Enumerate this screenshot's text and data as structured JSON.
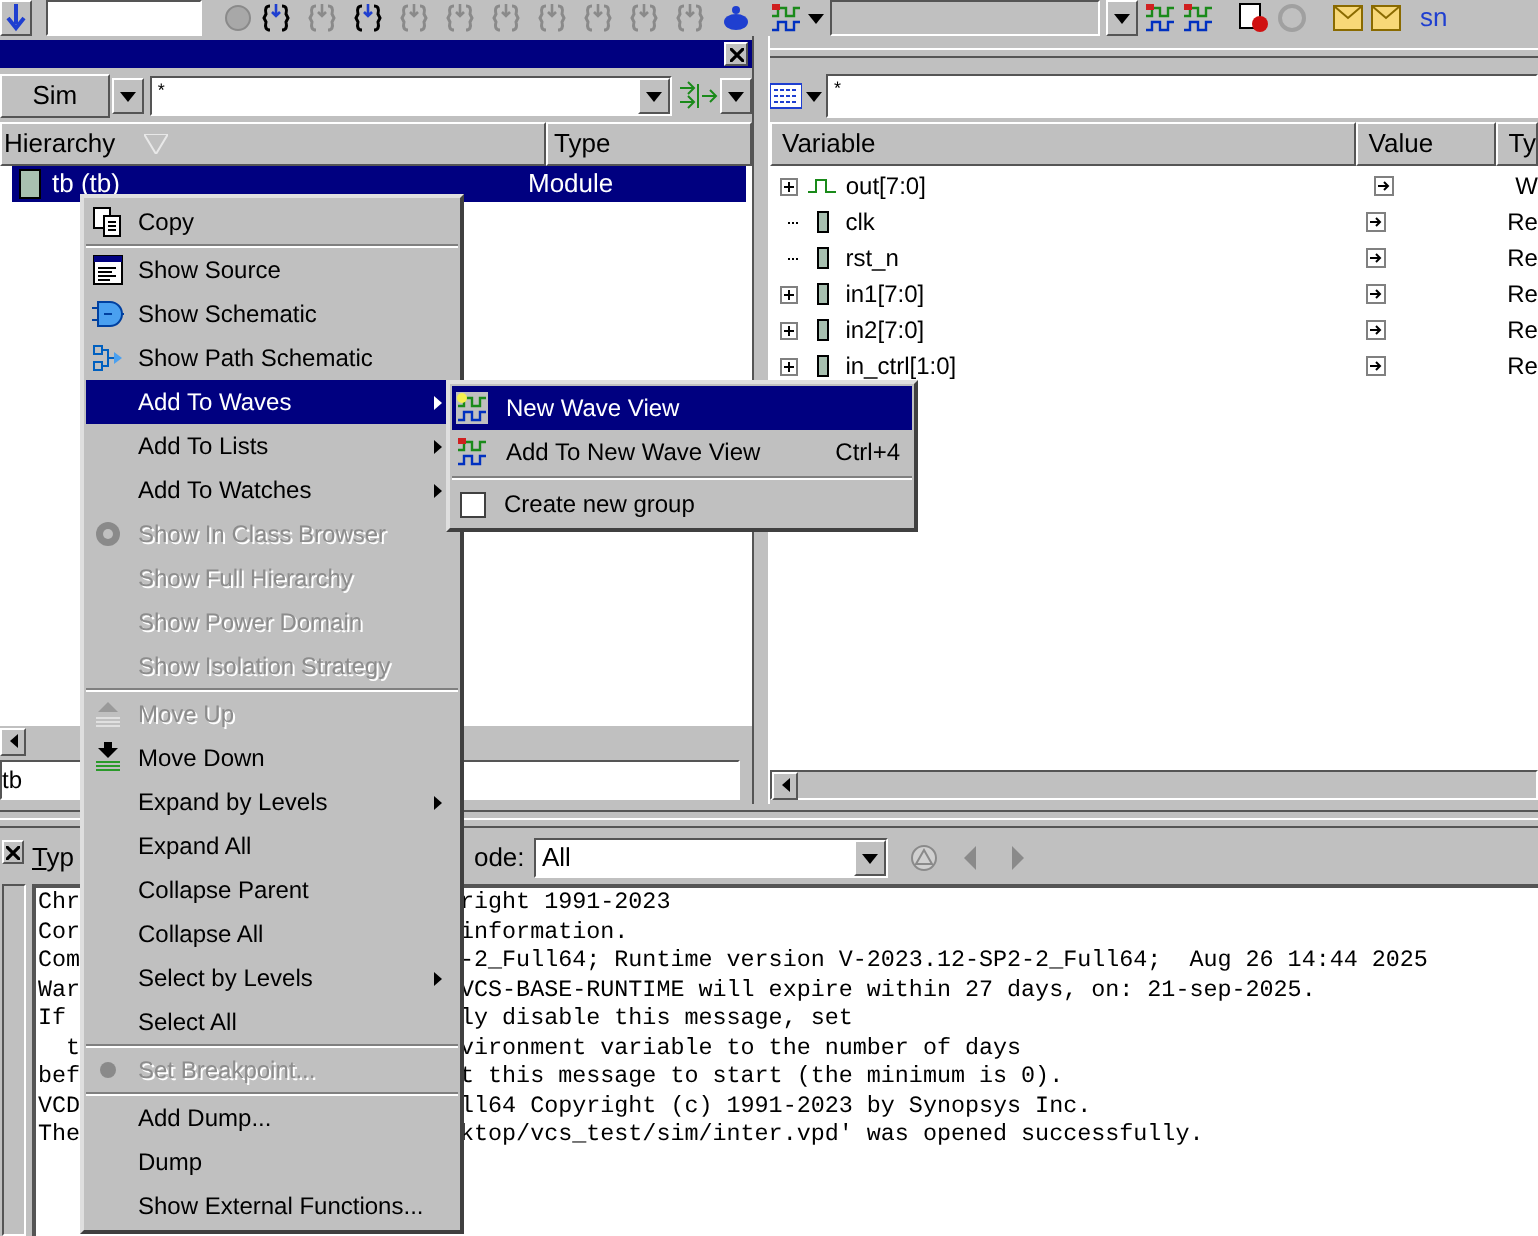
{
  "toolbar": {
    "logo": "sn"
  },
  "hierarchy_pane": {
    "scope_button": "Sim",
    "filter": "*",
    "columns": [
      "Hierarchy",
      "Type"
    ],
    "rows": [
      {
        "name": "tb (tb)",
        "type": "Module",
        "selected": true
      }
    ],
    "scope_field": "tb"
  },
  "variable_pane": {
    "filter": "*",
    "columns": [
      "Variable",
      "Value",
      "Ty"
    ],
    "rows": [
      {
        "name": "out[7:0]",
        "kind": "wire",
        "type": "W",
        "expandable": true
      },
      {
        "name": "clk",
        "kind": "reg",
        "type": "Re",
        "expandable": false
      },
      {
        "name": "rst_n",
        "kind": "reg",
        "type": "Re",
        "expandable": false
      },
      {
        "name": "in1[7:0]",
        "kind": "reg",
        "type": "Re",
        "expandable": true
      },
      {
        "name": "in2[7:0]",
        "kind": "reg",
        "type": "Re",
        "expandable": true
      },
      {
        "name": "in_ctrl[1:0]",
        "kind": "reg",
        "type": "Re",
        "expandable": true
      }
    ]
  },
  "console": {
    "type_label": "Typ",
    "mode_label": "ode:",
    "mode_value": "All",
    "lines": [
      {
        "left": "Chr",
        "right": "right 1991-2023"
      },
      {
        "left": "Cor",
        "right": "information."
      },
      {
        "left": "Com",
        "right": "-2_Full64; Runtime version V-2023.12-SP2-2_Full64;  Aug 26 14:44 2025"
      },
      {
        "left": "War",
        "right": "VCS-BASE-RUNTIME will expire within 27 days, on: 21-sep-2025."
      },
      {
        "left": "If",
        "right": "ly disable this message, set"
      },
      {
        "left": "  t",
        "right": "vironment variable to the number of days"
      },
      {
        "left": "bef",
        "right": "t this message to start (the minimum is 0)."
      },
      {
        "left": "VCD",
        "right": "ll64 Copyright (c) 1991-2023 by Synopsys Inc."
      },
      {
        "left": "The",
        "right": "ktop/vcs_test/sim/inter.vpd' was opened successfully."
      }
    ]
  },
  "context_menu": {
    "items": [
      {
        "kind": "item",
        "label": "Copy",
        "disabled": false,
        "submenu": false,
        "selected": false
      },
      {
        "kind": "separator"
      },
      {
        "kind": "item",
        "label": "Show Source",
        "disabled": false,
        "submenu": false,
        "selected": false
      },
      {
        "kind": "item",
        "label": "Show Schematic",
        "disabled": false,
        "submenu": false,
        "selected": false
      },
      {
        "kind": "item",
        "label": "Show Path Schematic",
        "disabled": false,
        "submenu": false,
        "selected": false
      },
      {
        "kind": "item",
        "label": "Add To Waves",
        "disabled": false,
        "submenu": true,
        "selected": true
      },
      {
        "kind": "item",
        "label": "Add To Lists",
        "disabled": false,
        "submenu": true,
        "selected": false
      },
      {
        "kind": "item",
        "label": "Add To Watches",
        "disabled": false,
        "submenu": true,
        "selected": false
      },
      {
        "kind": "item",
        "label": "Show In Class Browser",
        "disabled": true,
        "submenu": false,
        "selected": false
      },
      {
        "kind": "item",
        "label": "Show Full Hierarchy",
        "disabled": true,
        "submenu": false,
        "selected": false
      },
      {
        "kind": "item",
        "label": "Show Power Domain",
        "disabled": true,
        "submenu": false,
        "selected": false
      },
      {
        "kind": "item",
        "label": "Show Isolation Strategy",
        "disabled": true,
        "submenu": false,
        "selected": false
      },
      {
        "kind": "separator"
      },
      {
        "kind": "item",
        "label": "Move Up",
        "disabled": true,
        "submenu": false,
        "selected": false
      },
      {
        "kind": "item",
        "label": "Move Down",
        "disabled": false,
        "submenu": false,
        "selected": false
      },
      {
        "kind": "item",
        "label": "Expand by Levels",
        "disabled": false,
        "submenu": true,
        "selected": false
      },
      {
        "kind": "item",
        "label": "Expand All",
        "disabled": false,
        "submenu": false,
        "selected": false
      },
      {
        "kind": "item",
        "label": "Collapse Parent",
        "disabled": false,
        "submenu": false,
        "selected": false
      },
      {
        "kind": "item",
        "label": "Collapse All",
        "disabled": false,
        "submenu": false,
        "selected": false
      },
      {
        "kind": "item",
        "label": "Select by Levels",
        "disabled": false,
        "submenu": true,
        "selected": false
      },
      {
        "kind": "item",
        "label": "Select All",
        "disabled": false,
        "submenu": false,
        "selected": false
      },
      {
        "kind": "separator"
      },
      {
        "kind": "item",
        "label": "Set Breakpoint...",
        "disabled": true,
        "submenu": false,
        "selected": false
      },
      {
        "kind": "separator"
      },
      {
        "kind": "item",
        "label": "Add Dump...",
        "disabled": false,
        "submenu": false,
        "selected": false
      },
      {
        "kind": "item",
        "label": "Dump",
        "disabled": false,
        "submenu": false,
        "selected": false
      },
      {
        "kind": "item",
        "label": "Show External Functions...",
        "disabled": false,
        "submenu": false,
        "selected": false
      }
    ]
  },
  "submenu": {
    "items": [
      {
        "kind": "item",
        "label": "New Wave View",
        "selected": true
      },
      {
        "kind": "item",
        "label": "Add To New Wave View",
        "shortcut": "Ctrl+4",
        "selected": false
      },
      {
        "kind": "separator"
      },
      {
        "kind": "checkbox",
        "label": "Create new group",
        "checked": false,
        "selected": false
      }
    ]
  }
}
